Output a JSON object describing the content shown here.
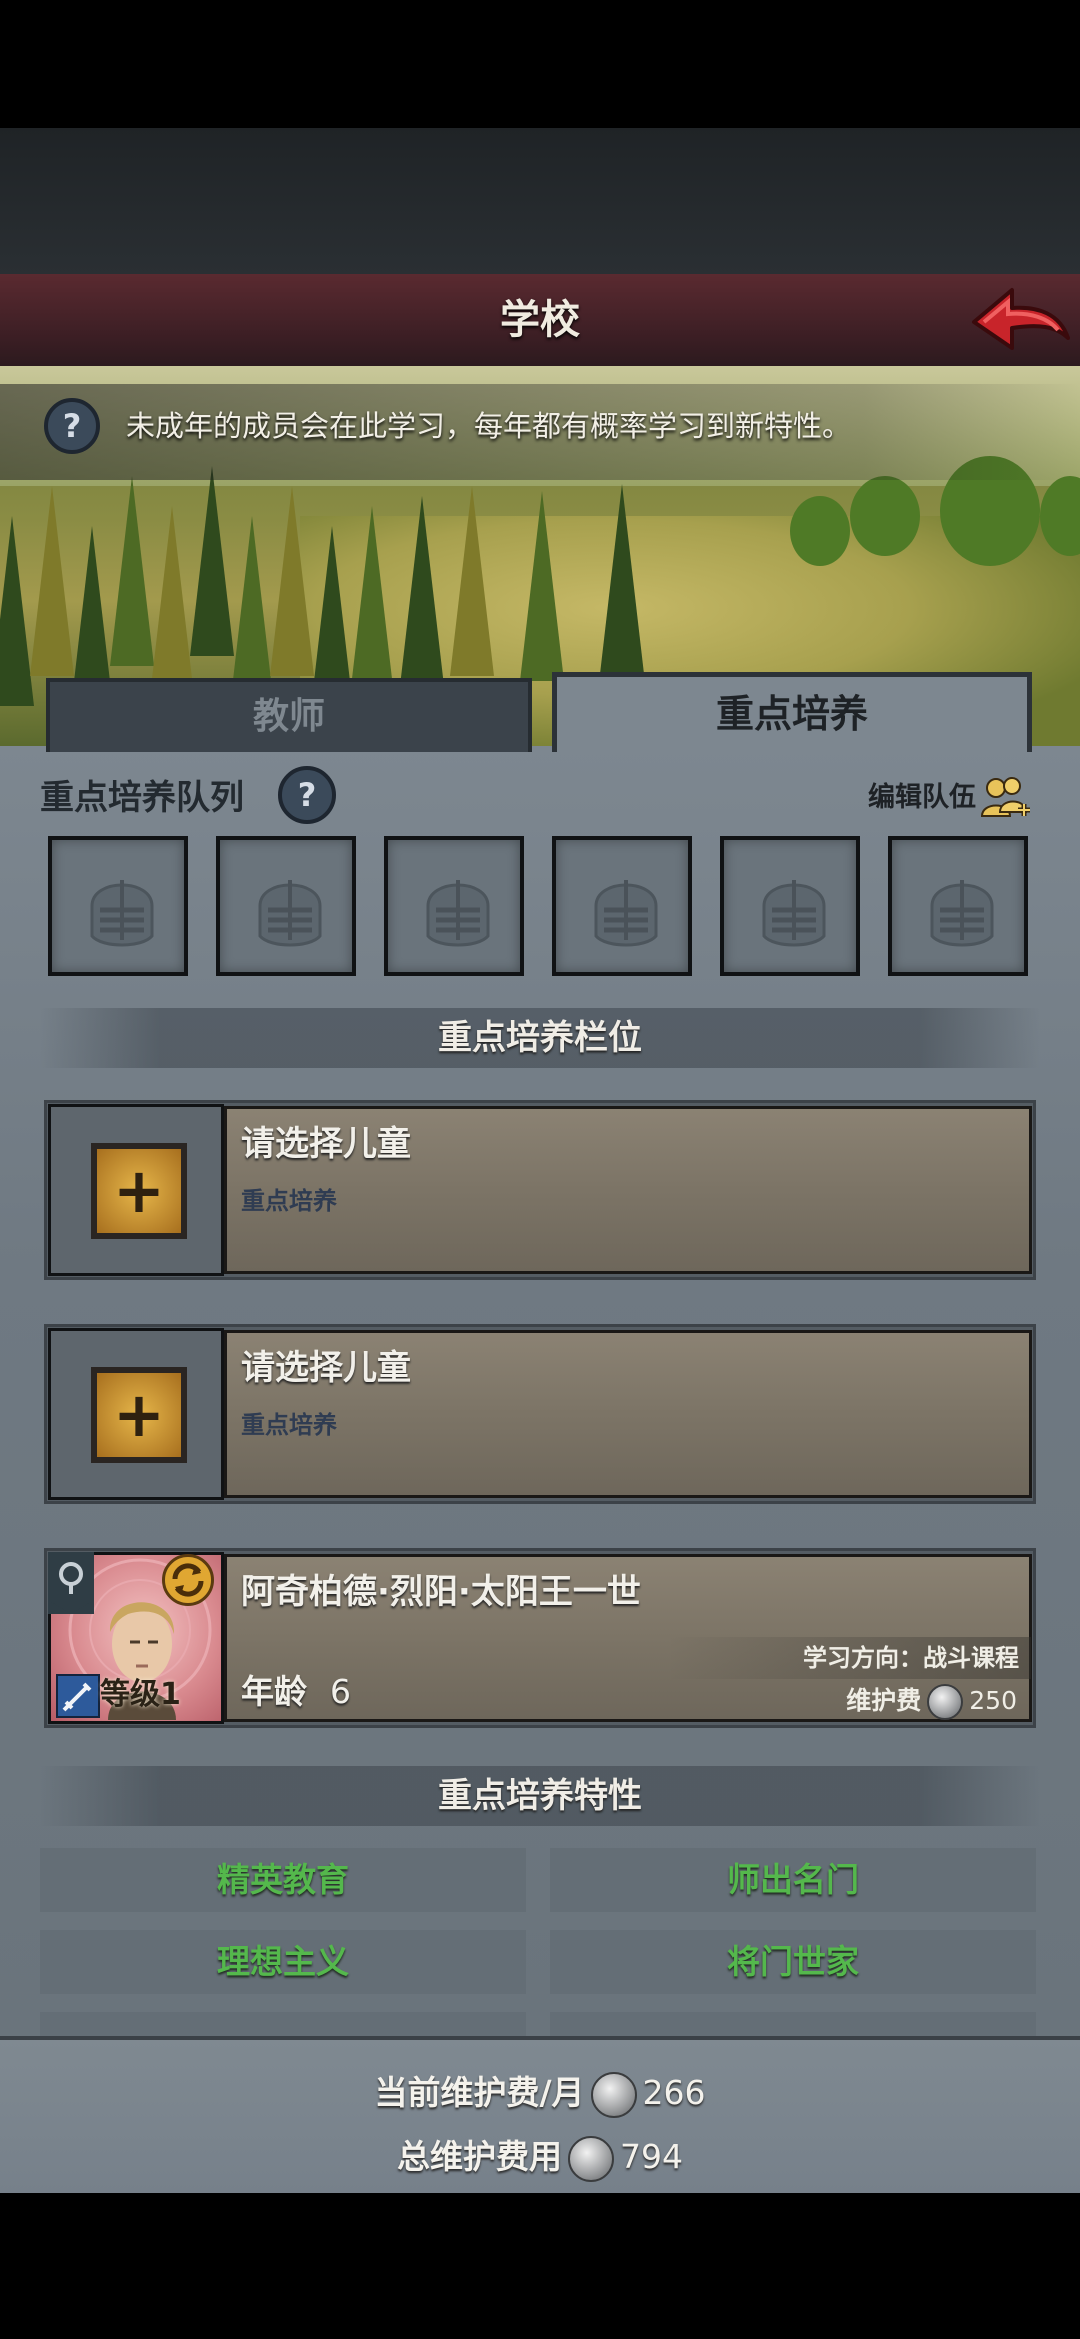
{
  "header": {
    "title": "学校"
  },
  "banner": {
    "info_text": "未成年的成员会在此学习，每年都有概率学习到新特性。",
    "help_glyph": "?"
  },
  "tabs": [
    {
      "label": "教师",
      "active": false
    },
    {
      "label": "重点培养",
      "active": true
    }
  ],
  "queue": {
    "title": "重点培养队列",
    "help_glyph": "?",
    "edit_label": "编辑队伍",
    "slot_icon": "knight-helmet-icon"
  },
  "slots_section": {
    "title": "重点培养栏位"
  },
  "slots": [
    {
      "name": "请选择儿童",
      "sub": "重点培养",
      "add_glyph": "+"
    },
    {
      "name": "请选择儿童",
      "sub": "重点培养",
      "add_glyph": "+"
    }
  ],
  "child": {
    "name": "阿奇柏德·烈阳·太阳王一世",
    "level_label": "等级",
    "level": "1",
    "age_label": "年龄",
    "age": "6",
    "direction": "学习方向：战斗课程",
    "fee_label": "维护费",
    "fee": "250"
  },
  "traits_section": {
    "title": "重点培养特性"
  },
  "traits": [
    "精英教育",
    "师出名门",
    "理想主义",
    "将门世家"
  ],
  "footer": {
    "monthly_label": "当前维护费/月",
    "monthly_value": "266",
    "total_label": "总维护费用",
    "total_value": "794"
  },
  "colors": {
    "title_bar": "#4a242a",
    "panel": "#737d86",
    "trait_text": "#54b84c",
    "back_arrow": "#c8242a"
  }
}
